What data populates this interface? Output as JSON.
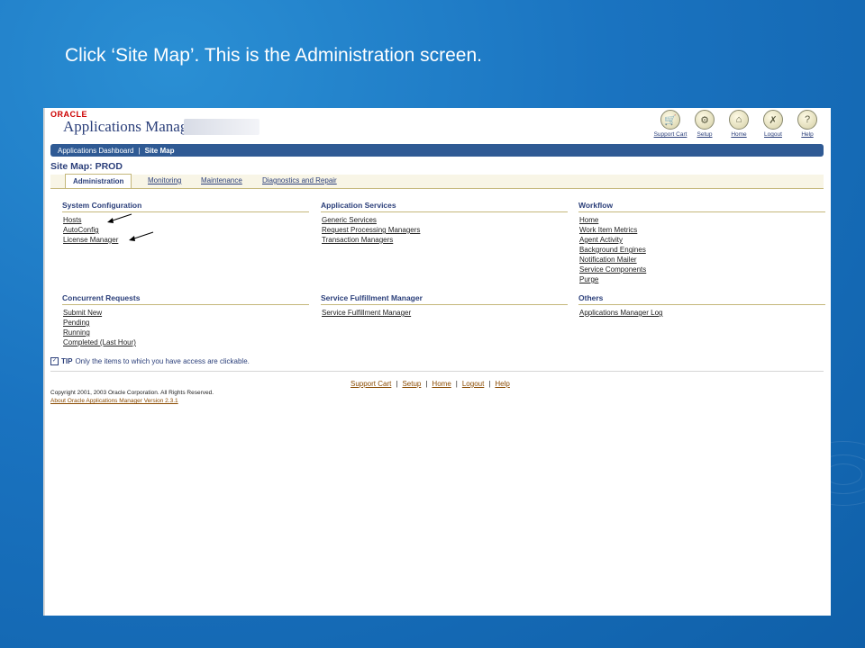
{
  "caption": "Click ‘Site Map’.  This is the Administration screen.",
  "app": {
    "brand_small": "ORACLE",
    "brand_name": "Applications Manager"
  },
  "top_icons": [
    {
      "label": "Support Cart",
      "icon": "cart-icon",
      "glyph": "🛒"
    },
    {
      "label": "Setup",
      "icon": "setup-icon",
      "glyph": "⚙"
    },
    {
      "label": "Home",
      "icon": "home-icon",
      "glyph": "⌂"
    },
    {
      "label": "Logout",
      "icon": "logout-icon",
      "glyph": "✗"
    },
    {
      "label": "Help",
      "icon": "help-icon",
      "glyph": "?"
    }
  ],
  "navbar": {
    "dashboard": "Applications Dashboard",
    "separator": "|",
    "current": "Site Map"
  },
  "page_title": "Site Map: PROD",
  "tabs": [
    "Administration",
    "Monitoring",
    "Maintenance",
    "Diagnostics and Repair"
  ],
  "sections": {
    "system_configuration": {
      "title": "System Configuration",
      "items": [
        "Hosts",
        "AutoConfig",
        "License Manager"
      ]
    },
    "application_services": {
      "title": "Application Services",
      "items": [
        "Generic Services",
        "Request Processing Managers",
        "Transaction Managers"
      ]
    },
    "workflow": {
      "title": "Workflow",
      "items": [
        "Home",
        "Work Item Metrics",
        "Agent Activity",
        "Background Engines",
        "Notification Mailer",
        "Service Components",
        "Purge"
      ]
    },
    "concurrent_requests": {
      "title": "Concurrent Requests",
      "items": [
        "Submit New",
        "Pending",
        "Running",
        "Completed (Last Hour)"
      ]
    },
    "service_fulfillment": {
      "title": "Service Fulfillment Manager",
      "items": [
        "Service Fulfillment Manager"
      ]
    },
    "others": {
      "title": "Others",
      "items": [
        "Applications Manager Log"
      ]
    }
  },
  "tip": {
    "label": "TIP",
    "text": "Only the items to which you have access are clickable."
  },
  "footer": {
    "links": [
      "Support Cart",
      "Setup",
      "Home",
      "Logout",
      "Help"
    ],
    "separator": "|",
    "copyright": "Copyright 2001, 2003 Oracle Corporation. All Rights Reserved.",
    "about": "About Oracle Applications Manager Version 2.3.1"
  },
  "colors": {
    "background": "#1a73c0",
    "header_bar": "#2f5a94",
    "link": "#2b3f7a",
    "accent": "#c4b77a"
  }
}
